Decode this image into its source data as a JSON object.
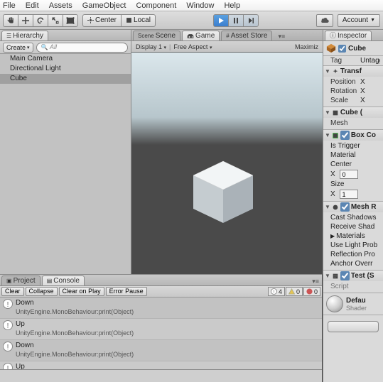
{
  "menu": {
    "file": "File",
    "edit": "Edit",
    "assets": "Assets",
    "gameobject": "GameObject",
    "component": "Component",
    "window": "Window",
    "help": "Help"
  },
  "toolbar": {
    "pivot_center": "Center",
    "pivot_local": "Local",
    "account": "Account"
  },
  "hierarchy": {
    "tab": "Hierarchy",
    "create": "Create",
    "search_placeholder": "All",
    "items": [
      {
        "name": "Main Camera"
      },
      {
        "name": "Directional Light"
      },
      {
        "name": "Cube"
      }
    ],
    "selected": 2
  },
  "center_tabs": {
    "scene": "Scene",
    "game": "Game",
    "asset_store": "Asset Store"
  },
  "game_toolbar": {
    "display": "Display 1",
    "aspect": "Free Aspect",
    "maximize": "Maximiz"
  },
  "bottom_tabs": {
    "project": "Project",
    "console": "Console"
  },
  "console": {
    "clear": "Clear",
    "collapse": "Collapse",
    "clear_on_play": "Clear on Play",
    "error_pause": "Error Pause",
    "count_info": "4",
    "count_warn": "0",
    "count_err": "0",
    "log_sub": "UnityEngine.MonoBehaviour:print(Object)",
    "logs": [
      {
        "msg": "Down"
      },
      {
        "msg": "Up"
      },
      {
        "msg": "Down"
      },
      {
        "msg": "Up"
      }
    ]
  },
  "inspector": {
    "tab": "Inspector",
    "name": "Cube",
    "tag_label": "Tag",
    "tag_value": "Untagg",
    "transform": {
      "title": "Transf",
      "position": "Position",
      "rotation": "Rotation",
      "scale": "Scale",
      "x_label": "X"
    },
    "mesh_filter": {
      "title": "Cube (",
      "field": "Mesh"
    },
    "box_collider": {
      "title": "Box Co",
      "is_trigger": "Is Trigger",
      "material": "Material",
      "center": "Center",
      "size": "Size",
      "x0": "0",
      "x1": "1"
    },
    "mesh_renderer": {
      "title": "Mesh R",
      "cast": "Cast Shadows",
      "receive": "Receive Shad",
      "materials": "Materials",
      "lightprob": "Use Light Prob",
      "reflect": "Reflection Pro",
      "anchor": "Anchor Overr"
    },
    "script": {
      "title": "Test (S",
      "field": "Script"
    },
    "material": {
      "name": "Defau",
      "shader": "Shader"
    }
  }
}
